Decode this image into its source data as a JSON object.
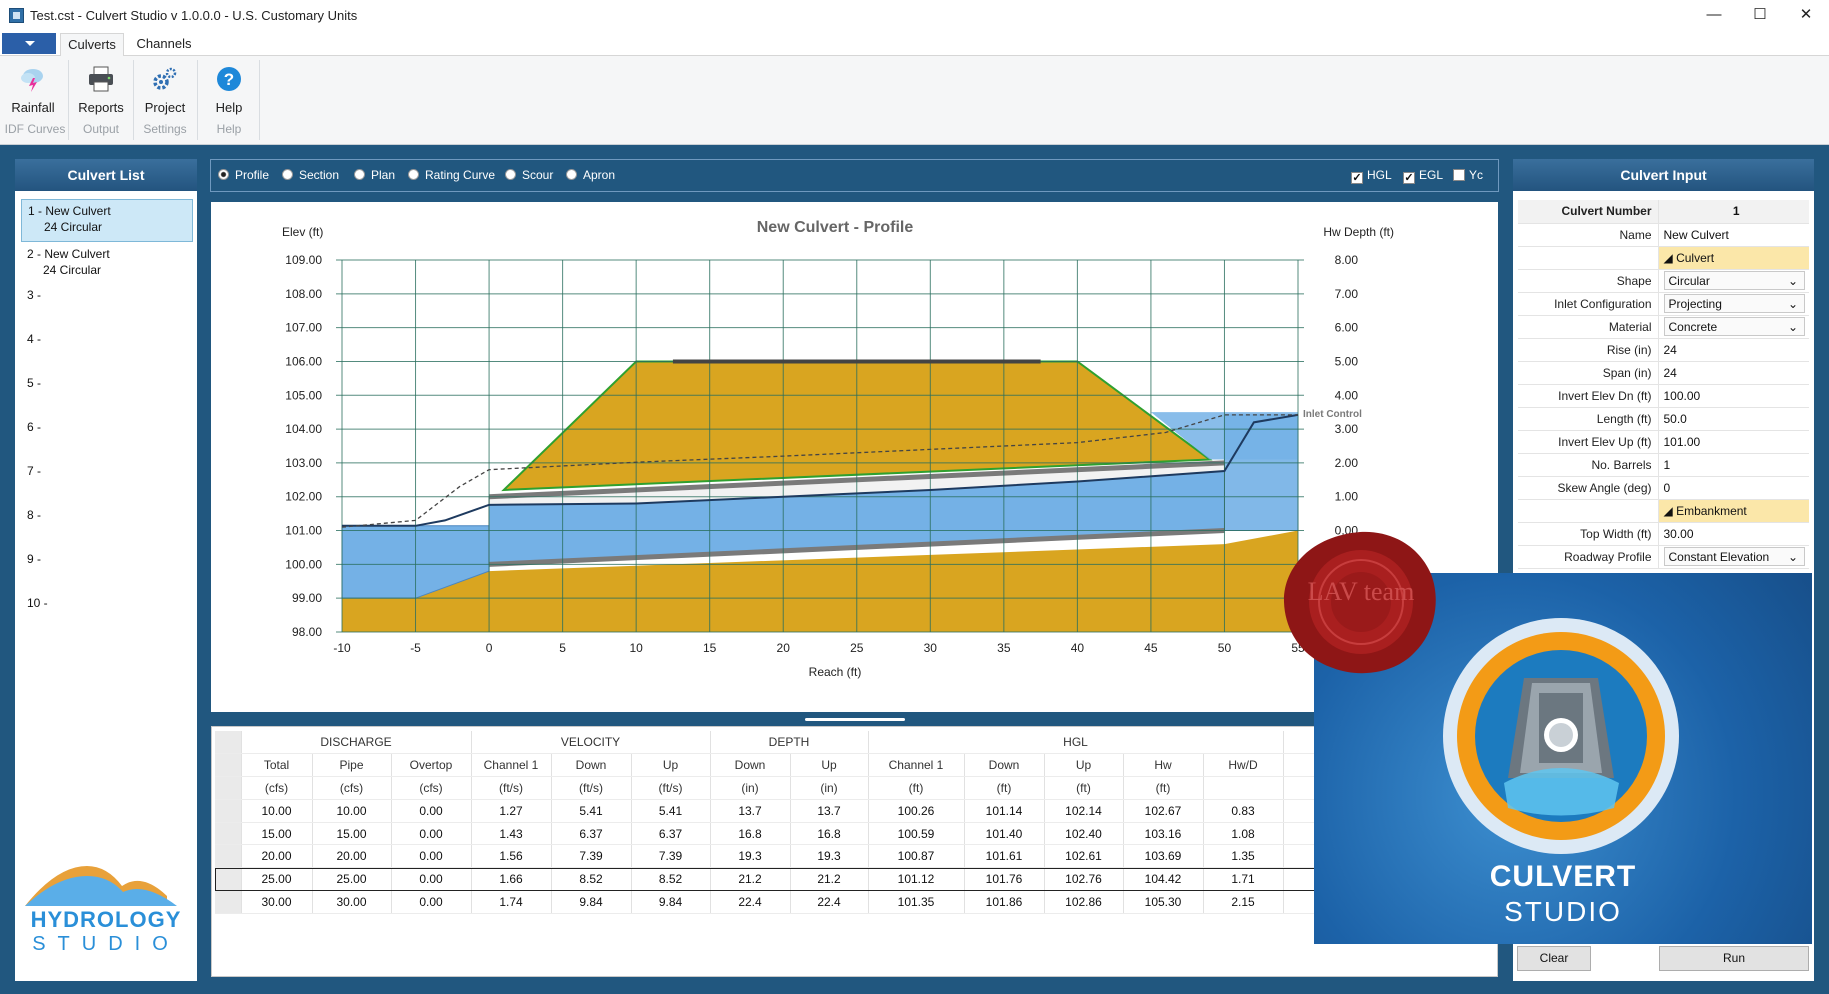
{
  "window": {
    "title": "Test.cst - Culvert Studio v 1.0.0.0 - U.S. Customary Units",
    "minimize": "—",
    "maximize": "☐",
    "close": "✕"
  },
  "tabs": [
    "Culverts",
    "Channels"
  ],
  "ribbon": {
    "buttons": [
      {
        "label": "Rainfall",
        "group": "IDF Curves",
        "icon": "cloud-lightning-icon"
      },
      {
        "label": "Reports",
        "group": "Output",
        "icon": "printer-icon"
      },
      {
        "label": "Project",
        "group": "Settings",
        "icon": "gears-icon"
      },
      {
        "label": "Help",
        "group": "Help",
        "icon": "help-circle-icon"
      }
    ]
  },
  "culvert_list": {
    "title": "Culvert List",
    "items": [
      {
        "line1": "1 - New Culvert",
        "line2": "24 Circular",
        "selected": true
      },
      {
        "line1": "2 - New Culvert",
        "line2": "24 Circular"
      },
      {
        "line1": "3 -"
      },
      {
        "line1": "4 -"
      },
      {
        "line1": "5 -"
      },
      {
        "line1": "6 -"
      },
      {
        "line1": "7 -"
      },
      {
        "line1": "8 -"
      },
      {
        "line1": "9 -"
      },
      {
        "line1": "10 -"
      }
    ]
  },
  "view_options": {
    "radios": [
      "Profile",
      "Section",
      "Plan",
      "Rating Curve",
      "Scour",
      "Apron"
    ],
    "selected": "Profile",
    "checks": [
      {
        "label": "HGL",
        "checked": true
      },
      {
        "label": "EGL",
        "checked": true
      },
      {
        "label": "Yc",
        "checked": false
      }
    ]
  },
  "chart_data": {
    "type": "line",
    "title": "New Culvert - Profile",
    "xlabel": "Reach (ft)",
    "ylabel_left": "Elev (ft)",
    "ylabel_right": "Hw Depth (ft)",
    "xlim": [
      -10,
      55
    ],
    "xticks": [
      -10,
      -5,
      0,
      5,
      10,
      15,
      20,
      25,
      30,
      35,
      40,
      45,
      50,
      55
    ],
    "ylim": [
      98,
      109
    ],
    "yticks": [
      "109.00",
      "108.00",
      "107.00",
      "106.00",
      "105.00",
      "104.00",
      "103.00",
      "102.00",
      "101.00",
      "100.00",
      "99.00",
      "98.00"
    ],
    "yticks_right": [
      "8.00",
      "7.00",
      "6.00",
      "5.00",
      "4.00",
      "3.00",
      "2.00",
      "1.00",
      "0.00"
    ],
    "annotation": "Inlet Control",
    "grid": true,
    "embankment": {
      "x": [
        1,
        10,
        40,
        49
      ],
      "y": [
        102.2,
        106,
        106,
        103.1
      ]
    },
    "roadway": {
      "x": [
        12.5,
        37.5
      ],
      "y": [
        106,
        106
      ]
    },
    "culvert_invert": {
      "x": [
        0,
        50
      ],
      "y": [
        100,
        101
      ]
    },
    "culvert_crown": {
      "x": [
        0,
        50
      ],
      "y": [
        102,
        103
      ]
    },
    "hgl": {
      "x": [
        -10,
        -5,
        -3,
        0,
        10,
        20,
        30,
        40,
        50,
        52,
        55
      ],
      "y": [
        101.14,
        101.14,
        101.3,
        101.76,
        101.8,
        102,
        102.2,
        102.45,
        102.76,
        104.2,
        104.42
      ]
    },
    "egl": {
      "x": [
        -10,
        -5,
        -2,
        0,
        10,
        20,
        30,
        40,
        46,
        50,
        55
      ],
      "y": [
        101.1,
        101.3,
        102.3,
        102.8,
        103.02,
        103.2,
        103.4,
        103.6,
        103.9,
        104.42,
        104.42
      ]
    },
    "tailwater": {
      "x": [
        -10,
        0
      ],
      "y": [
        101.14,
        101.14
      ]
    },
    "headwater": {
      "x": [
        50,
        55
      ],
      "y": [
        104.42,
        104.42
      ]
    }
  },
  "rating_table": {
    "groups": [
      {
        "label": "DISCHARGE",
        "span": 3
      },
      {
        "label": "VELOCITY",
        "span": 3
      },
      {
        "label": "DEPTH",
        "span": 2
      },
      {
        "label": "HGL",
        "span": 5
      }
    ],
    "columns": [
      "Total",
      "Pipe",
      "Overtop",
      "Channel 1",
      "Down",
      "Up",
      "Down",
      "Up",
      "Channel 1",
      "Down",
      "Up",
      "Hw",
      "Hw/D"
    ],
    "units": [
      "(cfs)",
      "(cfs)",
      "(cfs)",
      "(ft/s)",
      "(ft/s)",
      "(ft/s)",
      "(in)",
      "(in)",
      "(ft)",
      "(ft)",
      "(ft)",
      "(ft)",
      ""
    ],
    "rows": [
      [
        "10.00",
        "10.00",
        "0.00",
        "1.27",
        "5.41",
        "5.41",
        "13.7",
        "13.7",
        "100.26",
        "101.14",
        "102.14",
        "102.67",
        "0.83"
      ],
      [
        "15.00",
        "15.00",
        "0.00",
        "1.43",
        "6.37",
        "6.37",
        "16.8",
        "16.8",
        "100.59",
        "101.40",
        "102.40",
        "103.16",
        "1.08"
      ],
      [
        "20.00",
        "20.00",
        "0.00",
        "1.56",
        "7.39",
        "7.39",
        "19.3",
        "19.3",
        "100.87",
        "101.61",
        "102.61",
        "103.69",
        "1.35"
      ],
      [
        "25.00",
        "25.00",
        "0.00",
        "1.66",
        "8.52",
        "8.52",
        "21.2",
        "21.2",
        "101.12",
        "101.76",
        "102.76",
        "104.42",
        "1.71"
      ],
      [
        "30.00",
        "30.00",
        "0.00",
        "1.74",
        "9.84",
        "9.84",
        "22.4",
        "22.4",
        "101.35",
        "101.86",
        "102.86",
        "105.30",
        "2.15"
      ]
    ]
  },
  "culvert_input": {
    "title": "Culvert Input",
    "number_label": "Culvert Number",
    "number_value": "1",
    "name_label": "Name",
    "name_value": "New Culvert",
    "section_culvert": "Culvert",
    "shape_label": "Shape",
    "shape_value": "Circular",
    "inlet_label": "Inlet Configuration",
    "inlet_value": "Projecting",
    "material_label": "Material",
    "material_value": "Concrete",
    "rise_label": "Rise (in)",
    "rise_value": "24",
    "span_label": "Span (in)",
    "span_value": "24",
    "invdn_label": "Invert Elev Dn (ft)",
    "invdn_value": "100.00",
    "length_label": "Length (ft)",
    "length_value": "50.0",
    "invup_label": "Invert Elev Up (ft)",
    "invup_value": "101.00",
    "barrels_label": "No. Barrels",
    "barrels_value": "1",
    "skew_label": "Skew Angle (deg)",
    "skew_value": "0",
    "section_embankment": "Embankment",
    "topwidth_label": "Top Width (ft)",
    "topwidth_value": "30.00",
    "roadway_label": "Roadway Profile",
    "roadway_value": "Constant Elevation"
  },
  "buttons": {
    "clear": "Clear",
    "run": "Run"
  },
  "logos": {
    "hydrology_line1": "HYDROLOGY",
    "hydrology_line2": "STUDIO",
    "splash_line1": "CULVERT",
    "splash_line2": "STUDIO",
    "seal_text": "LAV team"
  },
  "colors": {
    "accent": "#21577f",
    "embankment": "#d9a520",
    "water": "#74b1e6",
    "section_header": "#fbe7a9",
    "grid": "#2a6f5e"
  }
}
